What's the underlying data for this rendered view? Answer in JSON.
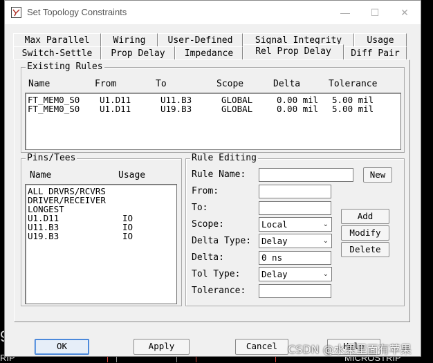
{
  "window": {
    "title": "Set Topology Constraints"
  },
  "tabs_top": [
    "Max Parallel",
    "Wiring",
    "User-Defined",
    "Signal Integrity",
    "Usage"
  ],
  "tabs_bottom": [
    "Switch-Settle",
    "Prop Delay",
    "Impedance",
    "Rel Prop Delay",
    "Diff Pair"
  ],
  "active_tab": "Rel Prop Delay",
  "existing_rules": {
    "title": "Existing Rules",
    "columns": [
      "Name",
      "From",
      "To",
      "Scope",
      "Delta",
      "Tolerance"
    ],
    "rows": [
      [
        "FT_MEM0_S0",
        "U1.D11",
        "U11.B3",
        "GLOBAL",
        "0.00 mil",
        "5.00 mil"
      ],
      [
        "FT_MEM0_S0",
        "U1.D11",
        "U19.B3",
        "GLOBAL",
        "0.00 mil",
        "5.00 mil"
      ]
    ]
  },
  "pins_tees": {
    "title": "Pins/Tees",
    "columns": [
      "Name",
      "Usage"
    ],
    "rows": [
      [
        "ALL DRVRS/RCVRS",
        ""
      ],
      [
        "DRIVER/RECEIVER",
        ""
      ],
      [
        "LONGEST",
        ""
      ],
      [
        "U1.D11",
        "IO"
      ],
      [
        "U11.B3",
        "IO"
      ],
      [
        "U19.B3",
        "IO"
      ]
    ]
  },
  "rule_editing": {
    "title": "Rule Editing",
    "rule_name_label": "Rule Name:",
    "rule_name_value": "",
    "new_button": "New",
    "from_label": "From:",
    "from_value": "",
    "to_label": "To:",
    "to_value": "",
    "scope_label": "Scope:",
    "scope_value": "Local",
    "delta_type_label": "Delta Type:",
    "delta_type_value": "Delay",
    "delta_label": "Delta:",
    "delta_value": "0 ns",
    "tol_type_label": "Tol Type:",
    "tol_type_value": "Delay",
    "tolerance_label": "Tolerance:",
    "tolerance_value": "",
    "add_button": "Add",
    "modify_button": "Modify",
    "delete_button": "Delete"
  },
  "footer": {
    "ok": "OK",
    "apply": "Apply",
    "cancel": "Cancel",
    "help": "Help"
  },
  "background": {
    "left_glyph": "9",
    "left_text": "RIP",
    "right_text": "MICROSTRIP",
    "watermark": "CSDN @水果里面有苹果"
  },
  "colors": {
    "dialog_bg": "#f0f0f0",
    "default_button_border": "#2a6fd0",
    "background": "#000000"
  }
}
